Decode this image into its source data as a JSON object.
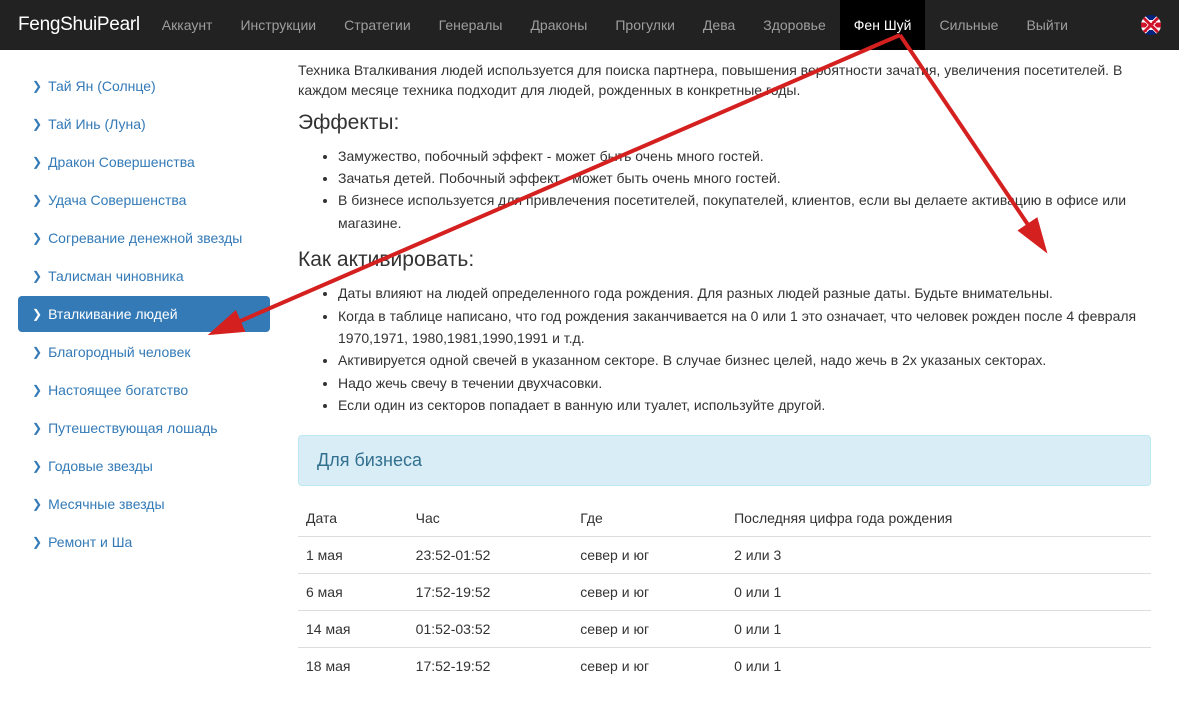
{
  "brand": "FengShuiPearl",
  "nav": [
    {
      "label": "Аккаунт"
    },
    {
      "label": "Инструкции"
    },
    {
      "label": "Стратегии"
    },
    {
      "label": "Генералы"
    },
    {
      "label": "Драконы"
    },
    {
      "label": "Прогулки"
    },
    {
      "label": "Дева"
    },
    {
      "label": "Здоровье"
    },
    {
      "label": "Фен Шуй",
      "active": true
    },
    {
      "label": "Сильные"
    },
    {
      "label": "Выйти"
    }
  ],
  "sidebar": [
    {
      "label": "Тай Ян (Солнце)"
    },
    {
      "label": "Тай Инь (Луна)"
    },
    {
      "label": "Дракон Совершенства"
    },
    {
      "label": "Удача Совершенства"
    },
    {
      "label": "Согревание денежной звезды"
    },
    {
      "label": "Талисман чиновника"
    },
    {
      "label": "Вталкивание людей",
      "active": true
    },
    {
      "label": "Благородный человек"
    },
    {
      "label": "Настоящее богатство"
    },
    {
      "label": "Путешествующая лошадь"
    },
    {
      "label": "Годовые звезды"
    },
    {
      "label": "Месячные звезды"
    },
    {
      "label": "Ремонт и Ша"
    }
  ],
  "content": {
    "intro": "Техника Вталкивания людей используется для поиска партнера, повышения вероятности зачатия, увеличения посетителей. В каждом месяце техника подходит для людей, рожденных в конкретные годы.",
    "h1": "Эффекты:",
    "effects": [
      "Замужество, побочный эффект - может быть очень много гостей.",
      "Зачатья детей. Побочный эффект - может быть очень много гостей.",
      "В бизнесе используется для привлечения посетителей, покупателей, клиентов, если вы делаете активацию в офисе или магазине."
    ],
    "h2": "Как активировать:",
    "activate": [
      "Даты влияют на людей определенного года рождения. Для разных людей разные даты. Будьте внимательны.",
      "Когда в таблице написано, что год рождения заканчивается на 0 или 1 это означает, что человек рожден после 4 февраля 1970,1971, 1980,1981,1990,1991 и т.д.",
      "Активируется одной свечей в указанном секторе. В случае бизнес целей, надо жечь в 2х указаных секторах.",
      "Надо жечь свечу в течении двухчасовки.",
      "Если один из секторов попадает в ванную или туалет, используйте другой."
    ],
    "alert": "Для бизнеса",
    "table": {
      "headers": [
        "Дата",
        "Час",
        "Где",
        "Последняя цифра года рождения"
      ],
      "rows": [
        [
          "1 мая",
          "23:52-01:52",
          "север и юг",
          "2 или 3"
        ],
        [
          "6 мая",
          "17:52-19:52",
          "север и юг",
          "0 или 1"
        ],
        [
          "14 мая",
          "01:52-03:52",
          "север и юг",
          "0 или 1"
        ],
        [
          "18 мая",
          "17:52-19:52",
          "север и юг",
          "0 или 1"
        ]
      ]
    }
  }
}
